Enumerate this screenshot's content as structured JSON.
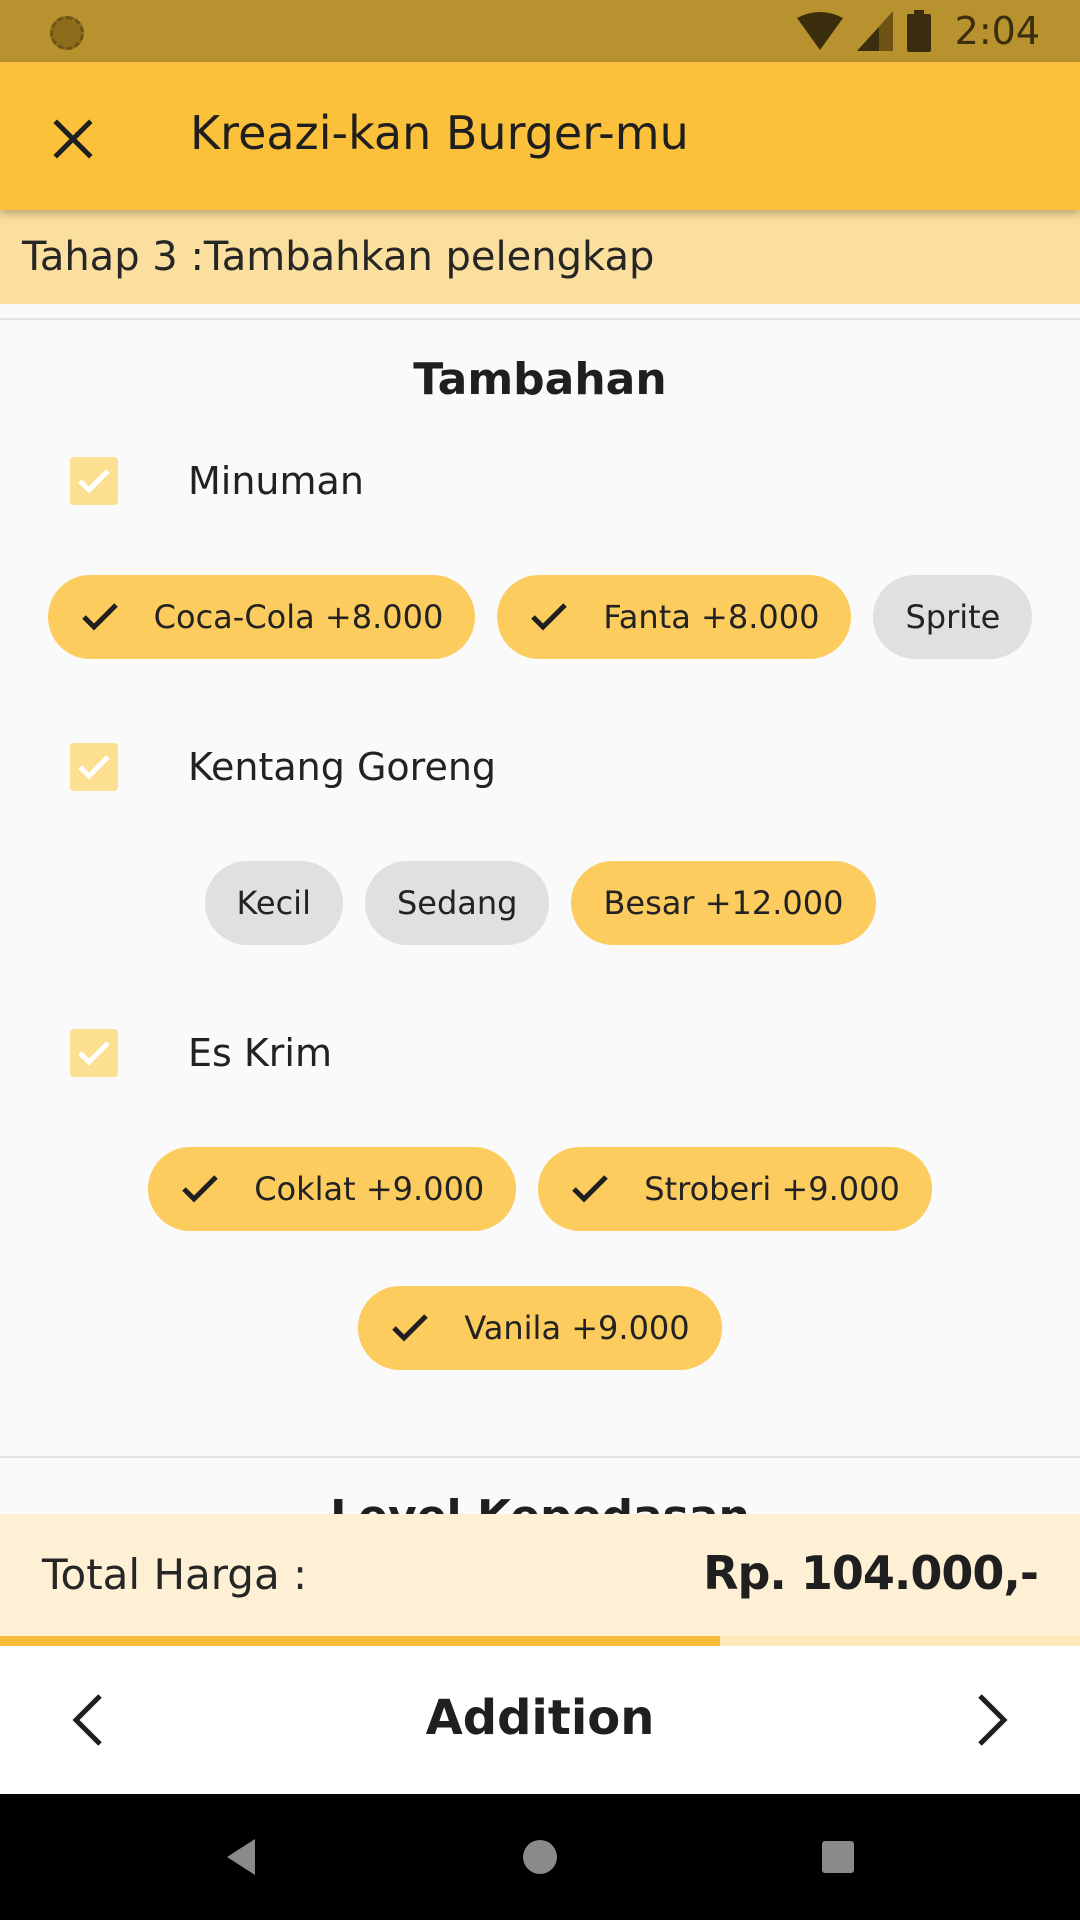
{
  "status_bar": {
    "time": "2:04"
  },
  "app_bar": {
    "title": "Kreazi-kan Burger-mu",
    "close_icon": "close-icon"
  },
  "step": {
    "text": "Tahap 3 :Tambahkan pelengkap"
  },
  "section": {
    "title": "Tambahan",
    "groups": [
      {
        "label": "Minuman",
        "checked": true,
        "chips": [
          {
            "label": "Coca-Cola +8.000",
            "selected": true
          },
          {
            "label": "Fanta +8.000",
            "selected": true
          },
          {
            "label": "Sprite",
            "selected": false
          }
        ]
      },
      {
        "label": "Kentang Goreng",
        "checked": true,
        "chips": [
          {
            "label": "Kecil",
            "selected": false
          },
          {
            "label": "Sedang",
            "selected": false
          },
          {
            "label": "Besar +12.000",
            "selected": true
          }
        ]
      },
      {
        "label": "Es Krim",
        "checked": true,
        "chips": [
          {
            "label": "Coklat +9.000",
            "selected": true
          },
          {
            "label": "Stroberi +9.000",
            "selected": true
          },
          {
            "label": "Vanila +9.000",
            "selected": true
          }
        ]
      }
    ]
  },
  "next_section": {
    "title": "Level Kepedasan"
  },
  "total": {
    "label": "Total Harga :",
    "value": "Rp. 104.000,-"
  },
  "progress": {
    "fraction": 0.667
  },
  "bottom_nav": {
    "title": "Addition",
    "prev_icon": "chevron-left-icon",
    "next_icon": "chevron-right-icon"
  },
  "colors": {
    "accent": "#fbc13a",
    "chip_selected": "#fccc5e",
    "chip_unselected": "#e0e0e0",
    "status_bar": "#b8922e"
  }
}
